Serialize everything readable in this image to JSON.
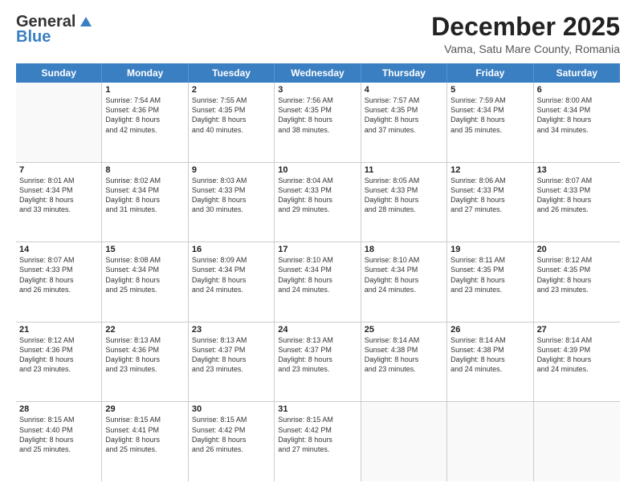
{
  "header": {
    "logo_general": "General",
    "logo_blue": "Blue",
    "main_title": "December 2025",
    "subtitle": "Vama, Satu Mare County, Romania"
  },
  "days_of_week": [
    "Sunday",
    "Monday",
    "Tuesday",
    "Wednesday",
    "Thursday",
    "Friday",
    "Saturday"
  ],
  "weeks": [
    [
      {
        "day": "",
        "info": ""
      },
      {
        "day": "1",
        "info": "Sunrise: 7:54 AM\nSunset: 4:36 PM\nDaylight: 8 hours\nand 42 minutes."
      },
      {
        "day": "2",
        "info": "Sunrise: 7:55 AM\nSunset: 4:35 PM\nDaylight: 8 hours\nand 40 minutes."
      },
      {
        "day": "3",
        "info": "Sunrise: 7:56 AM\nSunset: 4:35 PM\nDaylight: 8 hours\nand 38 minutes."
      },
      {
        "day": "4",
        "info": "Sunrise: 7:57 AM\nSunset: 4:35 PM\nDaylight: 8 hours\nand 37 minutes."
      },
      {
        "day": "5",
        "info": "Sunrise: 7:59 AM\nSunset: 4:34 PM\nDaylight: 8 hours\nand 35 minutes."
      },
      {
        "day": "6",
        "info": "Sunrise: 8:00 AM\nSunset: 4:34 PM\nDaylight: 8 hours\nand 34 minutes."
      }
    ],
    [
      {
        "day": "7",
        "info": "Sunrise: 8:01 AM\nSunset: 4:34 PM\nDaylight: 8 hours\nand 33 minutes."
      },
      {
        "day": "8",
        "info": "Sunrise: 8:02 AM\nSunset: 4:34 PM\nDaylight: 8 hours\nand 31 minutes."
      },
      {
        "day": "9",
        "info": "Sunrise: 8:03 AM\nSunset: 4:33 PM\nDaylight: 8 hours\nand 30 minutes."
      },
      {
        "day": "10",
        "info": "Sunrise: 8:04 AM\nSunset: 4:33 PM\nDaylight: 8 hours\nand 29 minutes."
      },
      {
        "day": "11",
        "info": "Sunrise: 8:05 AM\nSunset: 4:33 PM\nDaylight: 8 hours\nand 28 minutes."
      },
      {
        "day": "12",
        "info": "Sunrise: 8:06 AM\nSunset: 4:33 PM\nDaylight: 8 hours\nand 27 minutes."
      },
      {
        "day": "13",
        "info": "Sunrise: 8:07 AM\nSunset: 4:33 PM\nDaylight: 8 hours\nand 26 minutes."
      }
    ],
    [
      {
        "day": "14",
        "info": "Sunrise: 8:07 AM\nSunset: 4:33 PM\nDaylight: 8 hours\nand 26 minutes."
      },
      {
        "day": "15",
        "info": "Sunrise: 8:08 AM\nSunset: 4:34 PM\nDaylight: 8 hours\nand 25 minutes."
      },
      {
        "day": "16",
        "info": "Sunrise: 8:09 AM\nSunset: 4:34 PM\nDaylight: 8 hours\nand 24 minutes."
      },
      {
        "day": "17",
        "info": "Sunrise: 8:10 AM\nSunset: 4:34 PM\nDaylight: 8 hours\nand 24 minutes."
      },
      {
        "day": "18",
        "info": "Sunrise: 8:10 AM\nSunset: 4:34 PM\nDaylight: 8 hours\nand 24 minutes."
      },
      {
        "day": "19",
        "info": "Sunrise: 8:11 AM\nSunset: 4:35 PM\nDaylight: 8 hours\nand 23 minutes."
      },
      {
        "day": "20",
        "info": "Sunrise: 8:12 AM\nSunset: 4:35 PM\nDaylight: 8 hours\nand 23 minutes."
      }
    ],
    [
      {
        "day": "21",
        "info": "Sunrise: 8:12 AM\nSunset: 4:36 PM\nDaylight: 8 hours\nand 23 minutes."
      },
      {
        "day": "22",
        "info": "Sunrise: 8:13 AM\nSunset: 4:36 PM\nDaylight: 8 hours\nand 23 minutes."
      },
      {
        "day": "23",
        "info": "Sunrise: 8:13 AM\nSunset: 4:37 PM\nDaylight: 8 hours\nand 23 minutes."
      },
      {
        "day": "24",
        "info": "Sunrise: 8:13 AM\nSunset: 4:37 PM\nDaylight: 8 hours\nand 23 minutes."
      },
      {
        "day": "25",
        "info": "Sunrise: 8:14 AM\nSunset: 4:38 PM\nDaylight: 8 hours\nand 23 minutes."
      },
      {
        "day": "26",
        "info": "Sunrise: 8:14 AM\nSunset: 4:38 PM\nDaylight: 8 hours\nand 24 minutes."
      },
      {
        "day": "27",
        "info": "Sunrise: 8:14 AM\nSunset: 4:39 PM\nDaylight: 8 hours\nand 24 minutes."
      }
    ],
    [
      {
        "day": "28",
        "info": "Sunrise: 8:15 AM\nSunset: 4:40 PM\nDaylight: 8 hours\nand 25 minutes."
      },
      {
        "day": "29",
        "info": "Sunrise: 8:15 AM\nSunset: 4:41 PM\nDaylight: 8 hours\nand 25 minutes."
      },
      {
        "day": "30",
        "info": "Sunrise: 8:15 AM\nSunset: 4:42 PM\nDaylight: 8 hours\nand 26 minutes."
      },
      {
        "day": "31",
        "info": "Sunrise: 8:15 AM\nSunset: 4:42 PM\nDaylight: 8 hours\nand 27 minutes."
      },
      {
        "day": "",
        "info": ""
      },
      {
        "day": "",
        "info": ""
      },
      {
        "day": "",
        "info": ""
      }
    ]
  ]
}
